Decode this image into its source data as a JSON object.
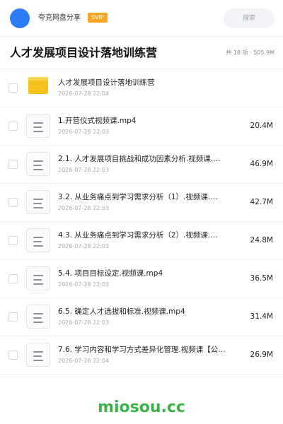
{
  "header": {
    "app_name": "夸克网盘分享",
    "badge": "SVIP",
    "search_placeholder": "搜索",
    "avatar_color": "#2a7cf7",
    "badge_color": "#f5a623"
  },
  "folder_title": "人才发展项目设计落地训练营",
  "summary": "共 18 项 · 505.9M",
  "files": [
    {
      "type": "folder",
      "icon": "folder-icon",
      "name": "人才发展项目设计落地训练营",
      "date": "2026-07-28 22:04",
      "size": ""
    },
    {
      "type": "file",
      "icon": "document-icon",
      "name": "1.开营仪式视频课.mp4",
      "date": "2026-07-28 22:03",
      "size": "20.4M"
    },
    {
      "type": "file",
      "icon": "document-icon",
      "name": "2.1. 人才发展项目挑战和成功因素分析.视频课.…",
      "date": "2026-07-28 22:03",
      "size": "46.9M"
    },
    {
      "type": "file",
      "icon": "document-icon",
      "name": "3.2. 从业务痛点到学习需求分析（1）.视频课.…",
      "date": "2026-07-28 22:03",
      "size": "42.7M"
    },
    {
      "type": "file",
      "icon": "document-icon",
      "name": "4.3. 从业务痛点到学习需求分析（2）.视频课.…",
      "date": "2026-07-28 22:03",
      "size": "24.8M"
    },
    {
      "type": "file",
      "icon": "document-icon",
      "name": "5.4. 项目目标设定.视频课.mp4",
      "date": "2026-07-28 22:03",
      "size": "36.5M"
    },
    {
      "type": "file",
      "icon": "document-icon",
      "name": "6.5. 确定人才选拔和标准.视频课.mp4",
      "date": "2026-07-28 22:03",
      "size": "31.4M"
    },
    {
      "type": "file",
      "icon": "document-icon",
      "name": "7.6. 学习内容和学习方式差异化管理.视频课【公…",
      "date": "2026-07-28 22:04",
      "size": "26.9M"
    }
  ],
  "watermark": "miosou.cc",
  "watermark_color": "#3cb34a"
}
